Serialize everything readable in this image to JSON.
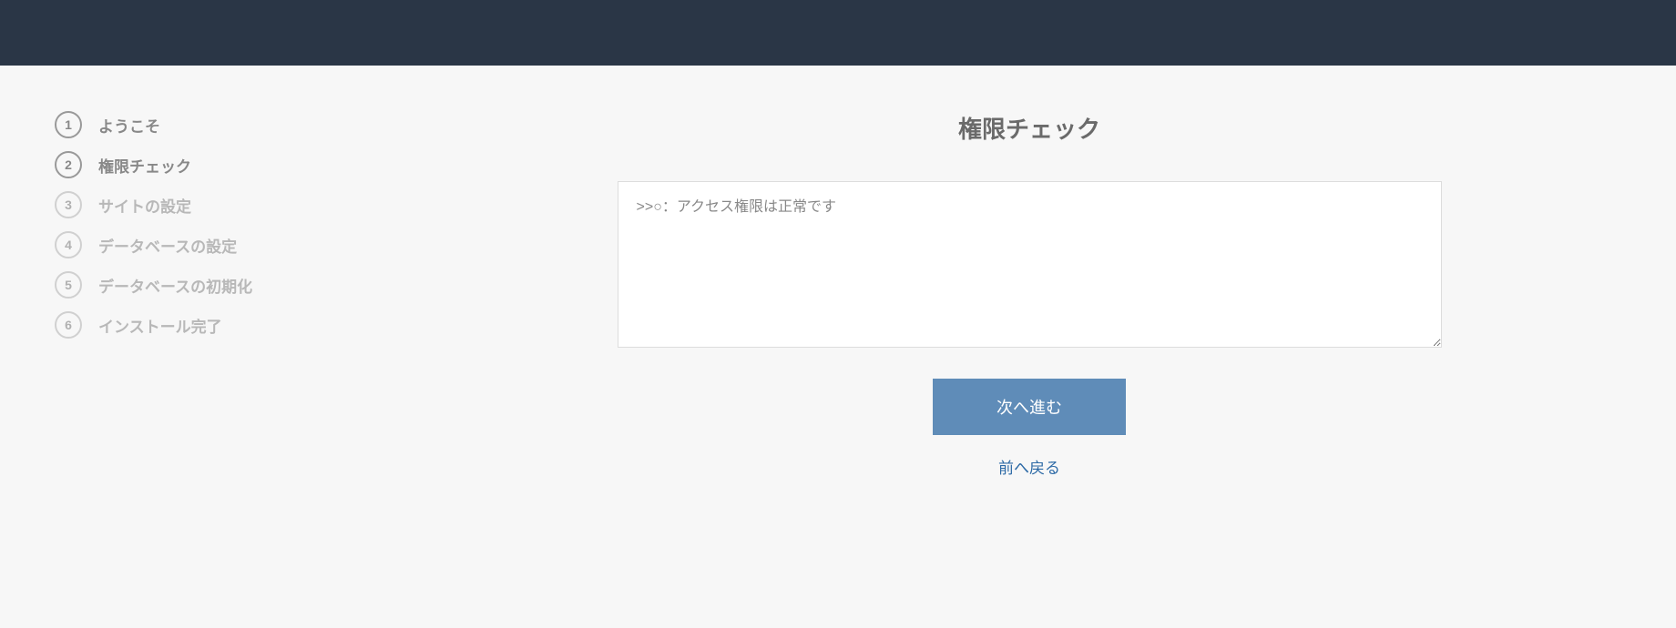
{
  "header": {},
  "sidebar": {
    "steps": [
      {
        "number": "1",
        "label": "ようこそ",
        "state": "completed"
      },
      {
        "number": "2",
        "label": "権限チェック",
        "state": "active"
      },
      {
        "number": "3",
        "label": "サイトの設定",
        "state": "pending"
      },
      {
        "number": "4",
        "label": "データベースの設定",
        "state": "pending"
      },
      {
        "number": "5",
        "label": "データベースの初期化",
        "state": "pending"
      },
      {
        "number": "6",
        "label": "インストール完了",
        "state": "pending"
      }
    ]
  },
  "main": {
    "title": "権限チェック",
    "output_text": ">>○：アクセス権限は正常です",
    "next_button_label": "次へ進む",
    "back_link_label": "前へ戻る"
  }
}
